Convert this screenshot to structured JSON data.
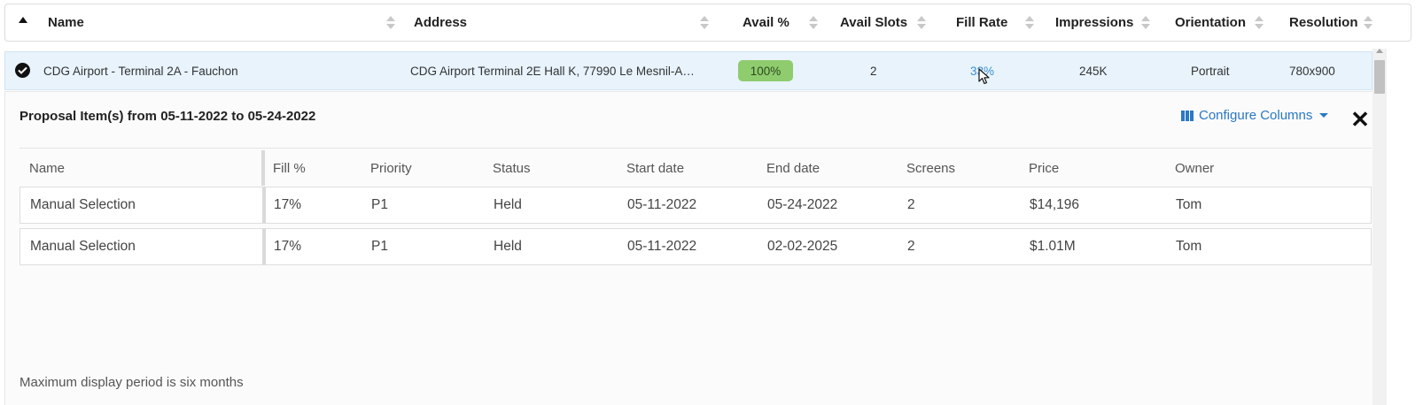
{
  "table": {
    "columns": [
      {
        "key": "name",
        "label": "Name"
      },
      {
        "key": "address",
        "label": "Address"
      },
      {
        "key": "avail_pct",
        "label": "Avail %"
      },
      {
        "key": "avail_slots",
        "label": "Avail Slots"
      },
      {
        "key": "fill_rate",
        "label": "Fill Rate"
      },
      {
        "key": "impressions",
        "label": "Impressions"
      },
      {
        "key": "orientation",
        "label": "Orientation"
      },
      {
        "key": "resolution",
        "label": "Resolution"
      }
    ],
    "row": {
      "name": "CDG Airport - Terminal 2A - Fauchon",
      "address": "CDG Airport Terminal 2E Hall K, 77990 Le Mesnil-A…",
      "avail_pct": "100%",
      "avail_slots": "2",
      "fill_rate": "33%",
      "impressions": "245K",
      "orientation": "Portrait",
      "resolution": "780x900"
    }
  },
  "panel": {
    "title": "Proposal Item(s) from 05-11-2022 to 05-24-2022",
    "configure_label": "Configure Columns",
    "close_glyph": "✕",
    "columns": [
      "Name",
      "Fill %",
      "Priority",
      "Status",
      "Start date",
      "End date",
      "Screens",
      "Price",
      "Owner"
    ],
    "rows": [
      [
        "Manual Selection",
        "17%",
        "P1",
        "Held",
        "05-11-2022",
        "05-24-2022",
        "2",
        "$14,196",
        "Tom"
      ],
      [
        "Manual Selection",
        "17%",
        "P1",
        "Held",
        "05-11-2022",
        "02-02-2025",
        "2",
        "$1.01M",
        "Tom"
      ]
    ],
    "footnote": "Maximum display period is six months"
  },
  "colors": {
    "avail_badge": "#8fcc6e",
    "link": "#3a8fd1",
    "selected_row": "#e8f3fc",
    "accent": "#2a78c3"
  }
}
